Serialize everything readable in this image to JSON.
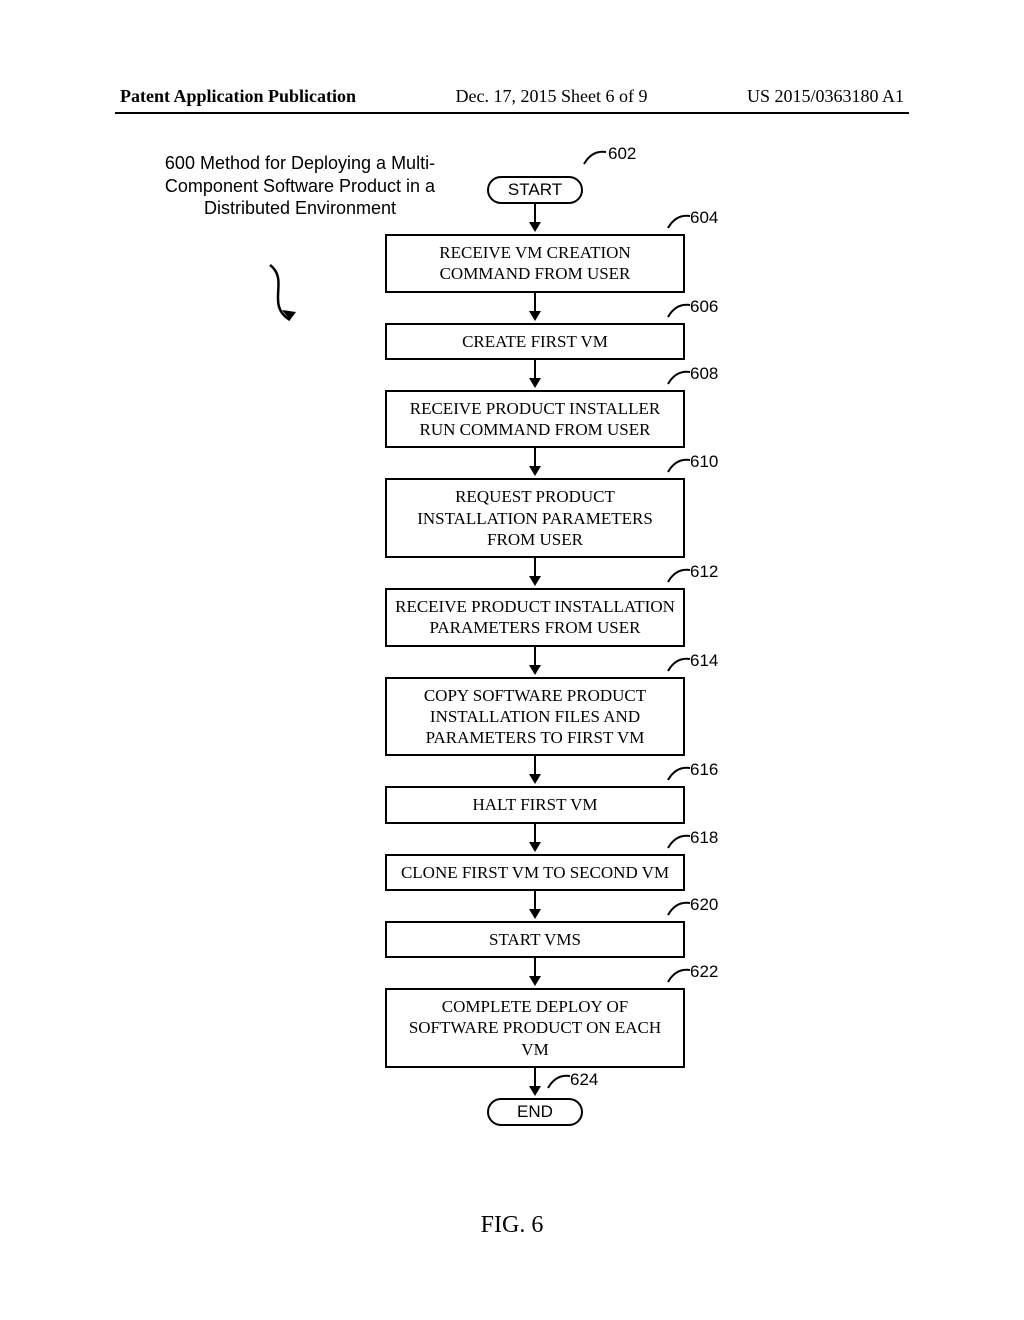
{
  "header": {
    "left": "Patent Application Publication",
    "center": "Dec. 17, 2015  Sheet 6 of 9",
    "right": "US 2015/0363180 A1"
  },
  "title600": "600 Method for Deploying a Multi-Component Software Product in a Distributed Environment",
  "figure_label": "FIG. 6",
  "chart_data": {
    "type": "flowchart",
    "nodes": [
      {
        "id": "602",
        "shape": "terminator",
        "text": "START"
      },
      {
        "id": "604",
        "shape": "process",
        "text": "RECEIVE VM CREATION COMMAND FROM USER"
      },
      {
        "id": "606",
        "shape": "process",
        "text": "CREATE FIRST VM"
      },
      {
        "id": "608",
        "shape": "process",
        "text": "RECEIVE PRODUCT INSTALLER RUN COMMAND FROM USER"
      },
      {
        "id": "610",
        "shape": "process",
        "text": "REQUEST PRODUCT INSTALLATION PARAMETERS FROM USER"
      },
      {
        "id": "612",
        "shape": "process",
        "text": "RECEIVE PRODUCT INSTALLATION PARAMETERS FROM USER"
      },
      {
        "id": "614",
        "shape": "process",
        "text": "COPY SOFTWARE PRODUCT INSTALLATION FILES AND PARAMETERS TO FIRST VM"
      },
      {
        "id": "616",
        "shape": "process",
        "text": "HALT FIRST VM"
      },
      {
        "id": "618",
        "shape": "process",
        "text": "CLONE FIRST VM TO SECOND VM"
      },
      {
        "id": "620",
        "shape": "process",
        "text": "START VMS"
      },
      {
        "id": "622",
        "shape": "process",
        "text": "COMPLETE DEPLOY OF SOFTWARE PRODUCT ON EACH  VM"
      },
      {
        "id": "624",
        "shape": "terminator",
        "text": "END"
      }
    ],
    "edges": [
      [
        "602",
        "604"
      ],
      [
        "604",
        "606"
      ],
      [
        "606",
        "608"
      ],
      [
        "608",
        "610"
      ],
      [
        "610",
        "612"
      ],
      [
        "612",
        "614"
      ],
      [
        "614",
        "616"
      ],
      [
        "616",
        "618"
      ],
      [
        "618",
        "620"
      ],
      [
        "620",
        "622"
      ],
      [
        "622",
        "624"
      ]
    ]
  }
}
